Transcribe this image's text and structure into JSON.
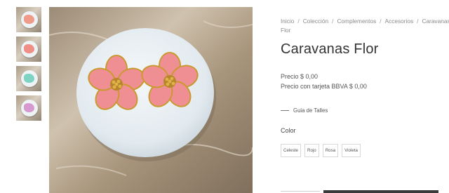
{
  "breadcrumb": {
    "items": [
      "Inicio",
      "Colección",
      "Complementos",
      "Accesorios",
      "Caravanas Flor"
    ],
    "separator": "/"
  },
  "product": {
    "title": "Caravanas Flor",
    "price_line": "Precio $ 0,00",
    "card_price_line": "Precio con tarjeta BBVA $ 0,00"
  },
  "size_guide": {
    "label": "Guia de Talles"
  },
  "color": {
    "label": "Color",
    "options": [
      "Celeste",
      "Rojo",
      "Rosa",
      "Violeta"
    ]
  },
  "thumbnails": [
    {
      "color": "#f09a8a",
      "name": "thumbnail-coral"
    },
    {
      "color": "#f08f86",
      "name": "thumbnail-red"
    },
    {
      "color": "#7fd3c3",
      "name": "thumbnail-mint"
    },
    {
      "color": "#d79ad0",
      "name": "thumbnail-violet"
    }
  ],
  "colors": {
    "petal": "#f08f93",
    "gold": "#c99a2e",
    "plate": "#e8eef2",
    "background": "#b8a58d"
  }
}
